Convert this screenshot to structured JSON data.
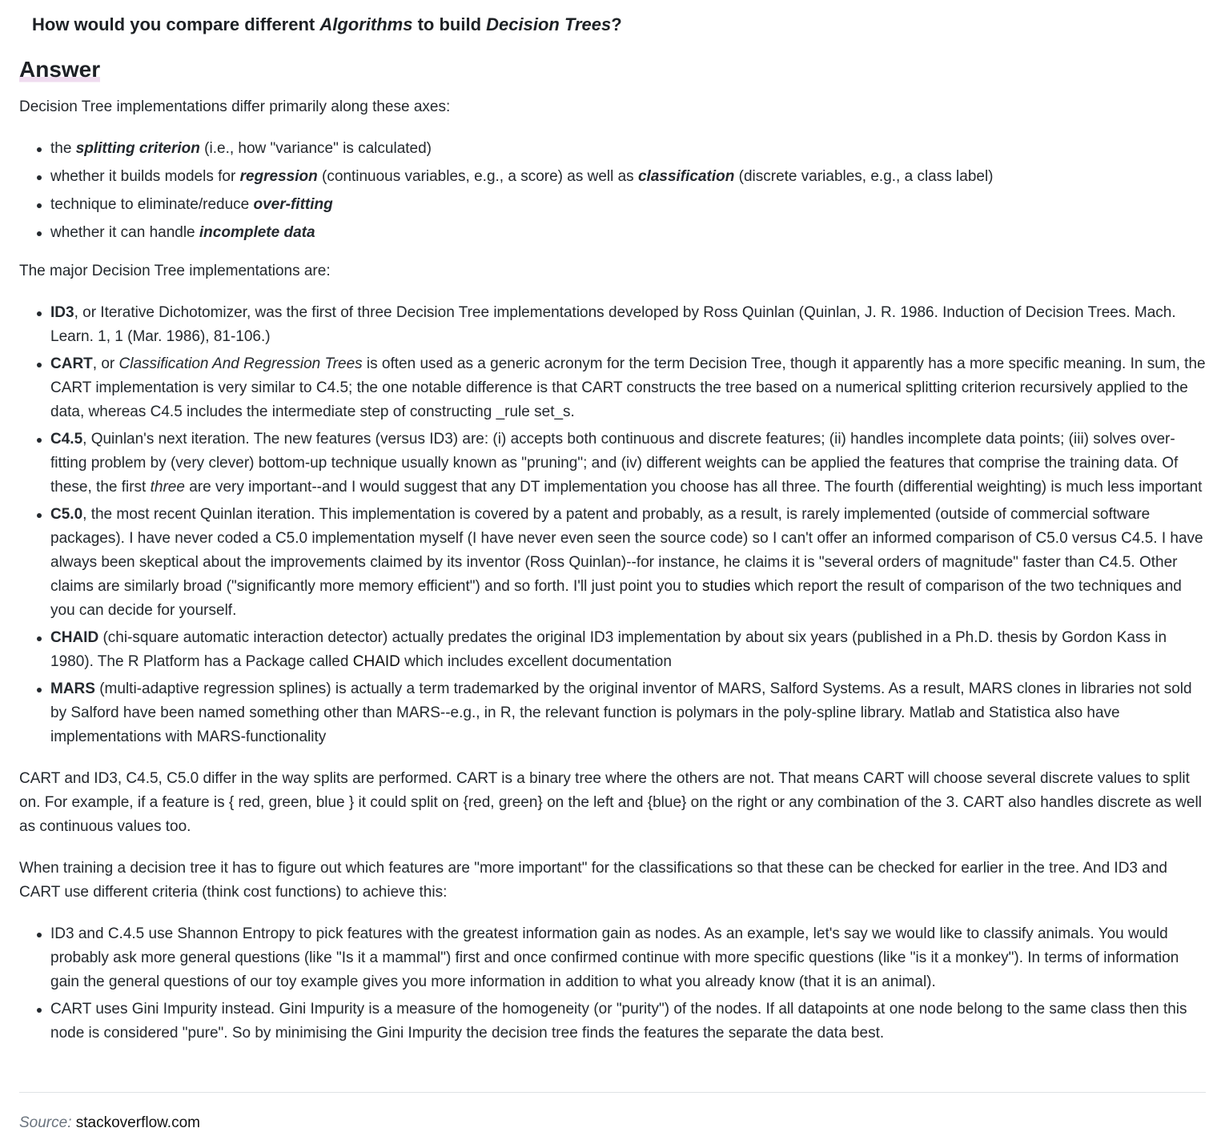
{
  "question": {
    "part1": "How would you compare different ",
    "term1": "Algorithms",
    "part2": " to build ",
    "term2": "Decision Trees",
    "part3": "?"
  },
  "answer_heading": "Answer",
  "intro": "Decision Tree implementations differ primarily along these axes:",
  "axes": [
    {
      "pre": "the ",
      "em": "splitting criterion",
      "post": " (i.e., how \"variance\" is calculated)"
    },
    {
      "pre": "whether it builds models for ",
      "em": "regression",
      "mid": " (continuous variables, e.g., a score) as well as ",
      "em2": "classification",
      "post": " (discrete variables, e.g., a class label)"
    },
    {
      "pre": "technique to eliminate/reduce ",
      "em": "over-fitting",
      "post": ""
    },
    {
      "pre": "whether it can handle ",
      "em": "incomplete data",
      "post": ""
    }
  ],
  "major_intro": "The major Decision Tree implementations are:",
  "implementations": [
    {
      "name": "ID3",
      "text": ", or Iterative Dichotomizer, was the first of three Decision Tree implementations developed by Ross Quinlan (Quinlan, J. R. 1986. Induction of Decision Trees. Mach. Learn. 1, 1 (Mar. 1986), 81-106.)"
    },
    {
      "name": "CART",
      "pre": ", or ",
      "italic": "Classification And Regression Trees",
      "text": " is often used as a generic acronym for the term Decision Tree, though it apparently has a more specific meaning. In sum, the CART implementation is very similar to C4.5; the one notable difference is that CART constructs the tree based on a numerical splitting criterion recursively applied to the data, whereas C4.5 includes the intermediate step of constructing _rule set_s."
    },
    {
      "name": "C4.5",
      "pre": ", Quinlan's next iteration. The new features (versus ID3) are: (i) accepts both continuous and discrete features; (ii) handles incomplete data points; (iii) solves over-fitting problem by (very clever) bottom-up technique usually known as \"pruning\"; and (iv) different weights can be applied the features that comprise the training data. Of these, the first ",
      "italic": "three",
      "text": " are very important--and I would suggest that any DT implementation you choose has all three. The fourth (differential weighting) is much less important"
    },
    {
      "name": "C5.0",
      "pre": ", the most recent Quinlan iteration. This implementation is covered by a patent and probably, as a result, is rarely implemented (outside of commercial software packages). I have never coded a C5.0 implementation myself (I have never even seen the source code) so I can't offer an informed comparison of C5.0 versus C4.5. I have always been skeptical about the improvements claimed by its inventor (Ross Quinlan)--for instance, he claims it is \"several orders of magnitude\" faster than C4.5. Other claims are similarly broad (\"significantly more memory efficient\") and so forth. I'll just point you to ",
      "link": "studies",
      "text": " which report the result of comparison of the two techniques and you can decide for yourself."
    },
    {
      "name": "CHAID",
      "pre": " (chi-square automatic interaction detector) actually predates the original ID3 implementation by about six years (published in a Ph.D. thesis by Gordon Kass in 1980). The R Platform has a Package called ",
      "link": "CHAID",
      "text": " which includes excellent documentation"
    },
    {
      "name": "MARS",
      "text": " (multi-adaptive regression splines) is actually a term trademarked by the original inventor of MARS, Salford Systems. As a result, MARS clones in libraries not sold by Salford have been named something other than MARS--e.g., in R, the relevant function is polymars in the poly-spline library. Matlab and Statistica also have implementations with MARS-functionality"
    }
  ],
  "para_splits": "CART and ID3, C4.5, C5.0 differ in the way splits are performed. CART is a binary tree where the others are not. That means CART will choose several discrete values to split on. For example, if a feature is { red, green, blue } it could split on {red, green} on the left and {blue} on the right or any combination of the 3. CART also handles discrete as well as continuous values too.",
  "para_training": "When training a decision tree it has to figure out which features are \"more important\" for the classifications so that these can be checked for earlier in the tree. And ID3 and CART use different criteria (think cost functions) to achieve this:",
  "criteria": [
    "ID3 and C.4.5 use Shannon Entropy to pick features with the greatest information gain as nodes. As an example, let's say we would like to classify animals. You would probably ask more general questions (like \"Is it a mammal\") first and once confirmed continue with more specific questions (like \"is it a monkey\"). In terms of information gain the general questions of our toy example gives you more information in addition to what you already know (that it is an animal).",
    "CART uses Gini Impurity instead. Gini Impurity is a measure of the homogeneity (or \"purity\") of the nodes. If all datapoints at one node belong to the same class then this node is considered \"pure\". So by minimising the Gini Impurity the decision tree finds the features the separate the data best."
  ],
  "source": {
    "label": "Source:",
    "value": "stackoverflow.com"
  }
}
